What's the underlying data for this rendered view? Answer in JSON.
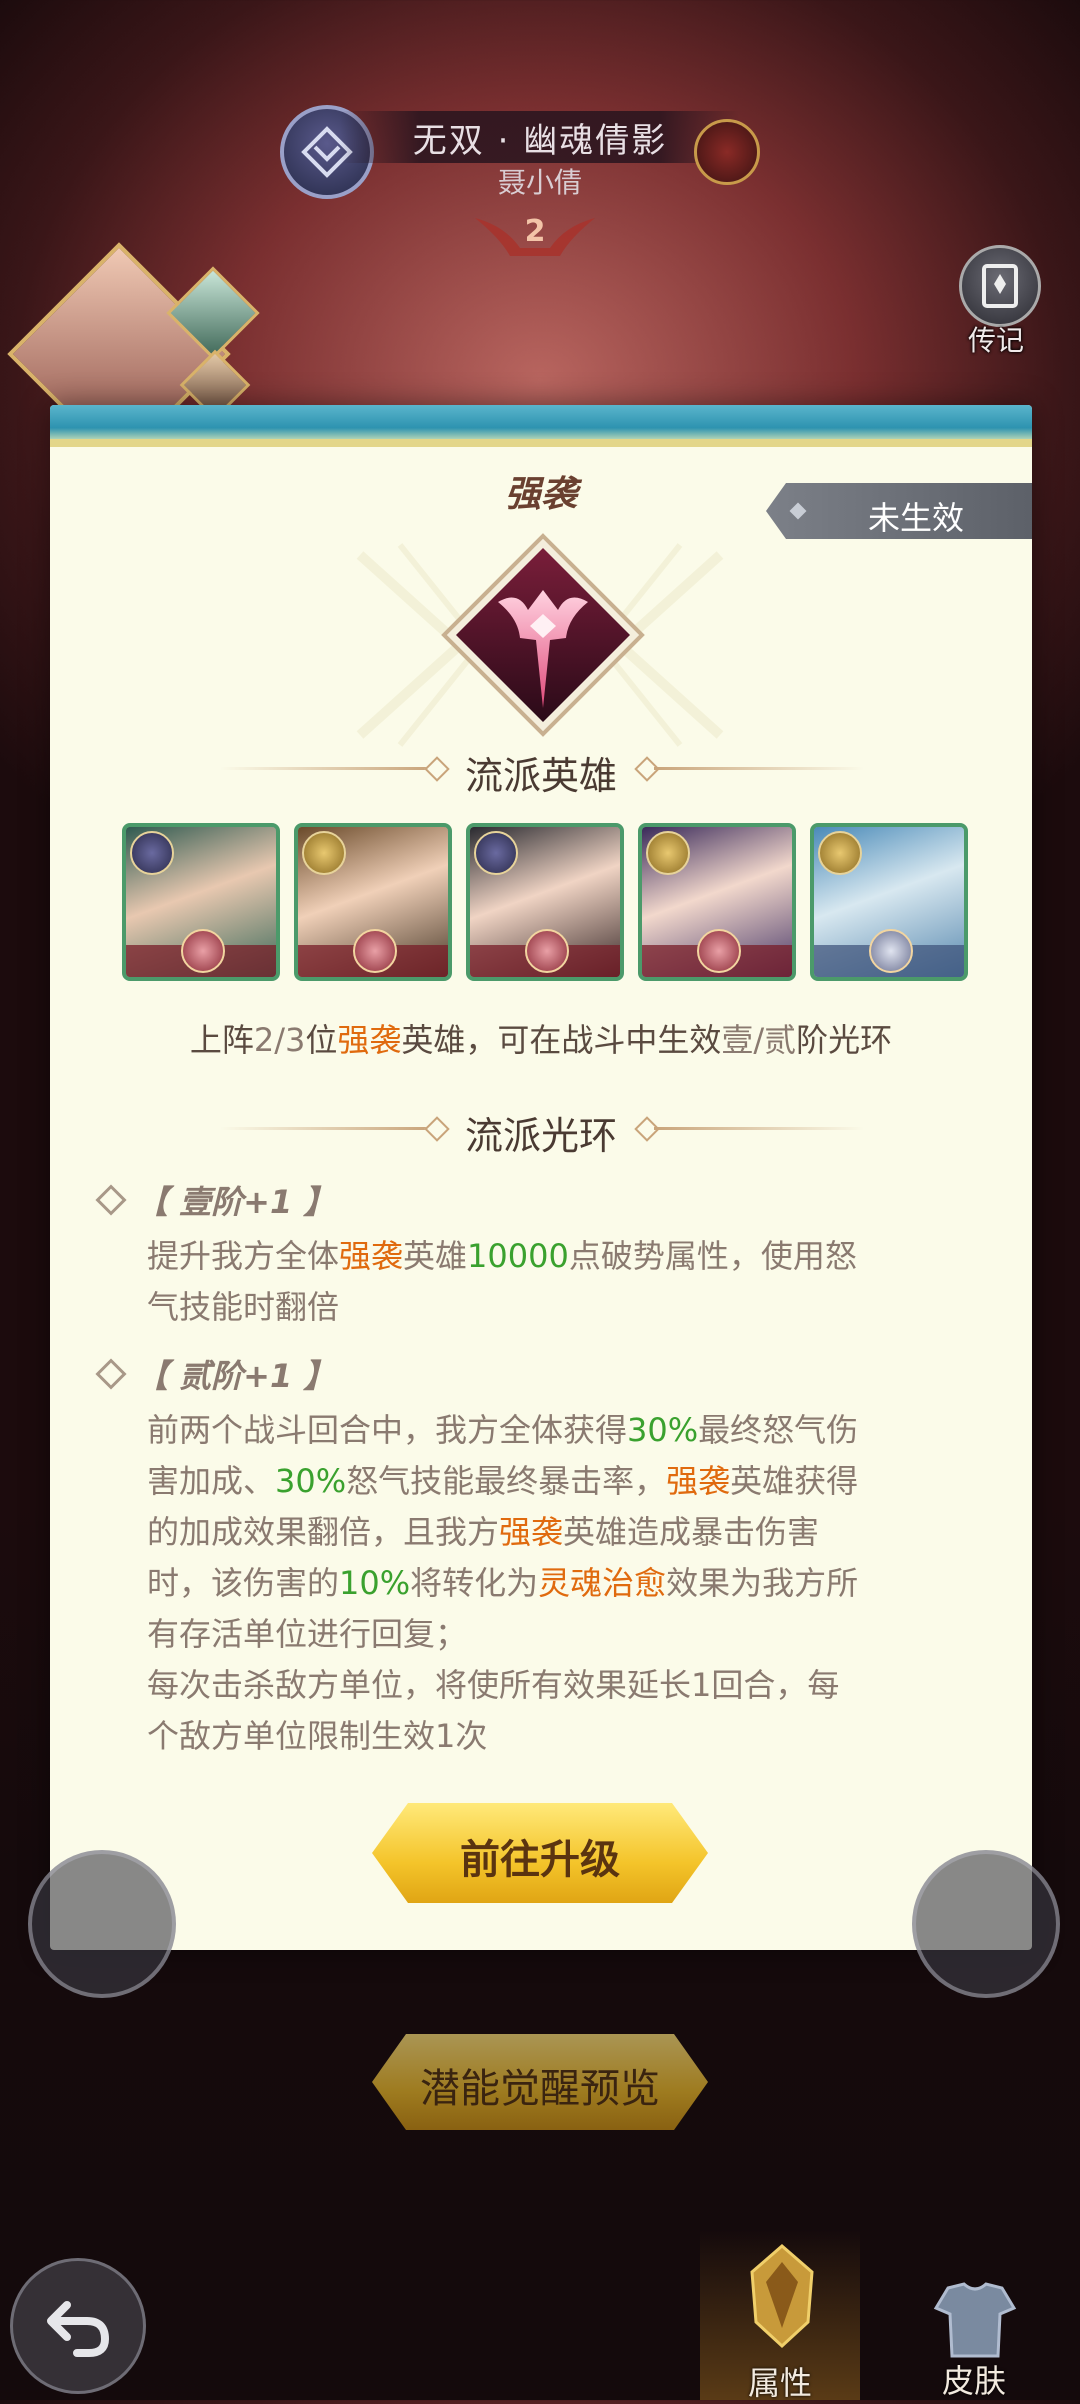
{
  "header": {
    "hero_title": "无双 · 幽魂倩影",
    "hero_name": "聂小倩",
    "star_level": "2",
    "legend_label": "传记"
  },
  "modal": {
    "set_title": "强袭",
    "status_tag": "未生效",
    "heroes_heading": "流派英雄",
    "heroes": [
      {
        "name": "hero-1",
        "border": "#4b9a6a"
      },
      {
        "name": "hero-2",
        "border": "#4b9a6a"
      },
      {
        "name": "hero-3",
        "border": "#4b9a6a"
      },
      {
        "name": "hero-4",
        "border": "#4b9a6a"
      },
      {
        "name": "hero-5",
        "border": "#4b9a6a"
      }
    ],
    "info": {
      "part1": "上阵",
      "part2": "2/3",
      "part3": "位",
      "part4": "强袭",
      "part5": "英雄，可在战斗中生效",
      "part6": "壹/贰",
      "part7": "阶光环"
    },
    "aura_heading": "流派光环",
    "tier1": {
      "heading": "【 壹阶+1 】",
      "l1a": "提升我方全体",
      "l1b": "强袭",
      "l1c": "英雄",
      "l1d": "10000",
      "l1e": "点破势属性，使用怒",
      "l2": "气技能时翻倍"
    },
    "tier2": {
      "heading": "【 贰阶+1 】",
      "l1a": "前两个战斗回合中，我方全体获得",
      "l1b": "30%",
      "l1c": "最终怒气伤",
      "l2a": "害加成、",
      "l2b": "30%",
      "l2c": "怒气技能最终暴击率，",
      "l2d": "强袭",
      "l2e": "英雄获得",
      "l3a": "的加成效果翻倍，且我方",
      "l3b": "强袭",
      "l3c": "英雄造成暴击伤害",
      "l4a": "时，该伤害的",
      "l4b": "10%",
      "l4c": "将转化为",
      "l4d": "灵魂治愈",
      "l4e": "效果为我方所",
      "l5": "有存活单位进行回复；",
      "l6": "每次击杀敌方单位，将使所有效果延长1回合，每",
      "l7": "个敌方单位限制生效1次"
    },
    "upgrade_button": "前往升级"
  },
  "bottom": {
    "preview_button": "潜能觉醒预览",
    "nav_attributes": "属性",
    "nav_skin": "皮肤"
  },
  "colors": {
    "highlight_orange": "#e06a0e",
    "highlight_green": "#3aa12e",
    "modal_bg": "#fbfbe9",
    "button_gold": "#f4c42a"
  }
}
